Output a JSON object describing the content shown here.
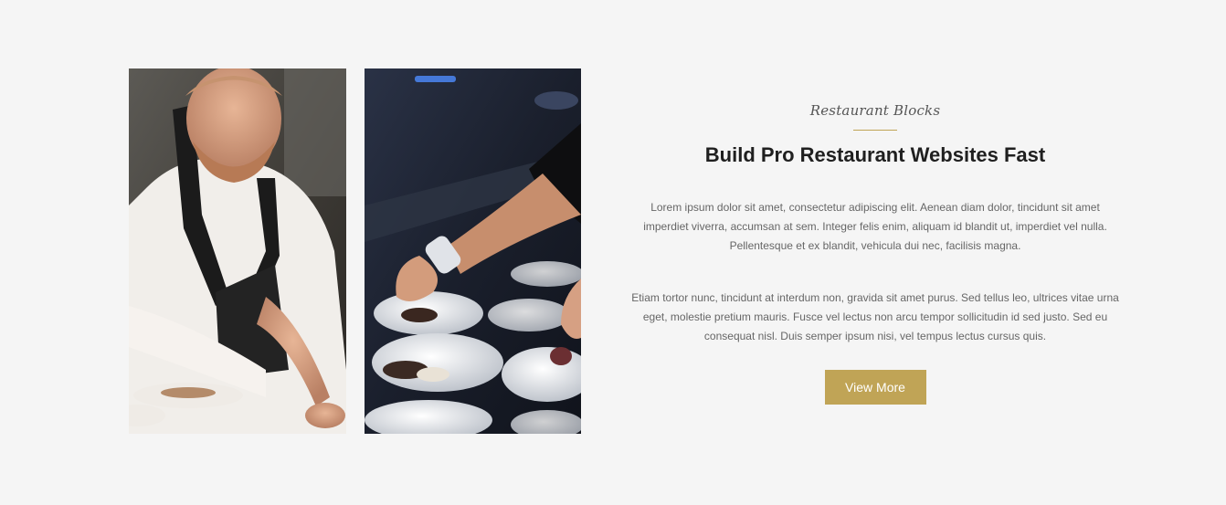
{
  "section": {
    "eyebrow": "Restaurant Blocks",
    "title": "Build Pro Restaurant Websites Fast",
    "paragraphs": [
      "Lorem ipsum dolor sit amet, consectetur adipiscing elit. Aenean diam dolor, tincidunt sit amet imperdiet viverra, accumsan at sem. Integer felis enim, aliquam id blandit ut, imperdiet vel nulla. Pellentesque et ex blandit, vehicula dui nec, facilisis magna.",
      "Etiam tortor nunc, tincidunt at interdum non, gravida sit amet purus. Sed tellus leo, ultrices vitae urna eget, molestie pretium mauris. Fusce vel lectus non arcu tempor sollicitudin id sed justo. Sed eu consequat nisl. Duis semper ipsum nisi, vel tempus lectus cursus quis."
    ],
    "button_label": "View More"
  },
  "images": [
    {
      "subject": "chef-in-apron-plating-food"
    },
    {
      "subject": "hands-plating-dishes"
    }
  ],
  "colors": {
    "background": "#f5f5f5",
    "accent": "#c0a456",
    "title": "#1f1f1f",
    "body_text": "#666666"
  }
}
